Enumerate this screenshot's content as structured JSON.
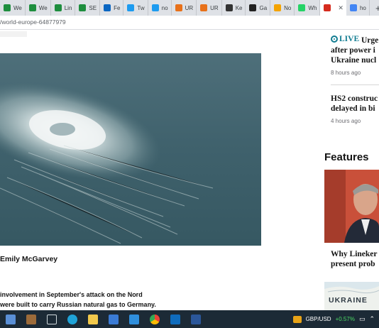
{
  "browser": {
    "tabs": [
      {
        "label": "We",
        "icon": "plus-doc-icon",
        "color": "#1e8e3e"
      },
      {
        "label": "We",
        "icon": "plus-doc-icon",
        "color": "#1e8e3e"
      },
      {
        "label": "Lin",
        "icon": "plus-doc-icon",
        "color": "#1e8e3e"
      },
      {
        "label": "SE",
        "icon": "plus-doc-icon",
        "color": "#1e8e3e"
      },
      {
        "label": "Fe",
        "icon": "linkedin-icon",
        "color": "#0a66c2"
      },
      {
        "label": "Tw",
        "icon": "twitter-icon",
        "color": "#1d9bf0"
      },
      {
        "label": "no",
        "icon": "twitter-icon",
        "color": "#1d9bf0"
      },
      {
        "label": "UR",
        "icon": "circle-p-icon",
        "color": "#e8711a"
      },
      {
        "label": "UR",
        "icon": "circle-p-icon",
        "color": "#e8711a"
      },
      {
        "label": "Ke",
        "icon": "mail-icon",
        "color": "#333333"
      },
      {
        "label": "Ga",
        "icon": "s-logo-icon",
        "color": "#222222"
      },
      {
        "label": "No",
        "icon": "trend-icon",
        "color": "#f4a300"
      },
      {
        "label": "Wh",
        "icon": "whatsapp-icon",
        "color": "#25d366"
      },
      {
        "label": "",
        "icon": "swiss-flag-icon",
        "color": "#d52b1e",
        "active": true
      },
      {
        "label": "ho",
        "icon": "google-icon",
        "color": "#4285f4"
      }
    ],
    "new_tab": "+",
    "close_glyph": "✕",
    "url": "/world-europe-64877979"
  },
  "article": {
    "byline": "Emily McGarvey",
    "body_line1": "involvement in September's attack on the Nord",
    "body_line2": "were built to carry Russian natural gas to Germany."
  },
  "sidebar": {
    "story1": {
      "live": "LIVE",
      "headline1": "Urge",
      "headline2": "after power i",
      "headline3": "Ukraine nucl",
      "time": "8 hours ago"
    },
    "story2": {
      "headline1": "HS2 construc",
      "headline2": "delayed in bi",
      "time": "4 hours ago"
    },
    "features_title": "Features",
    "feature1": {
      "headline1": "Why Lineker",
      "headline2": "present prob"
    },
    "feature2": {
      "label": "UKRAINE"
    }
  },
  "taskbar": {
    "ticker_symbol": "GBP/USD",
    "ticker_change": "+0.57%",
    "icons": [
      "laptop-icon",
      "briefcase-icon",
      "task-view-icon",
      "edge-icon",
      "file-explorer-icon",
      "store-icon",
      "mail-app-icon",
      "chrome-icon",
      "outlook-icon",
      "word-icon"
    ]
  }
}
